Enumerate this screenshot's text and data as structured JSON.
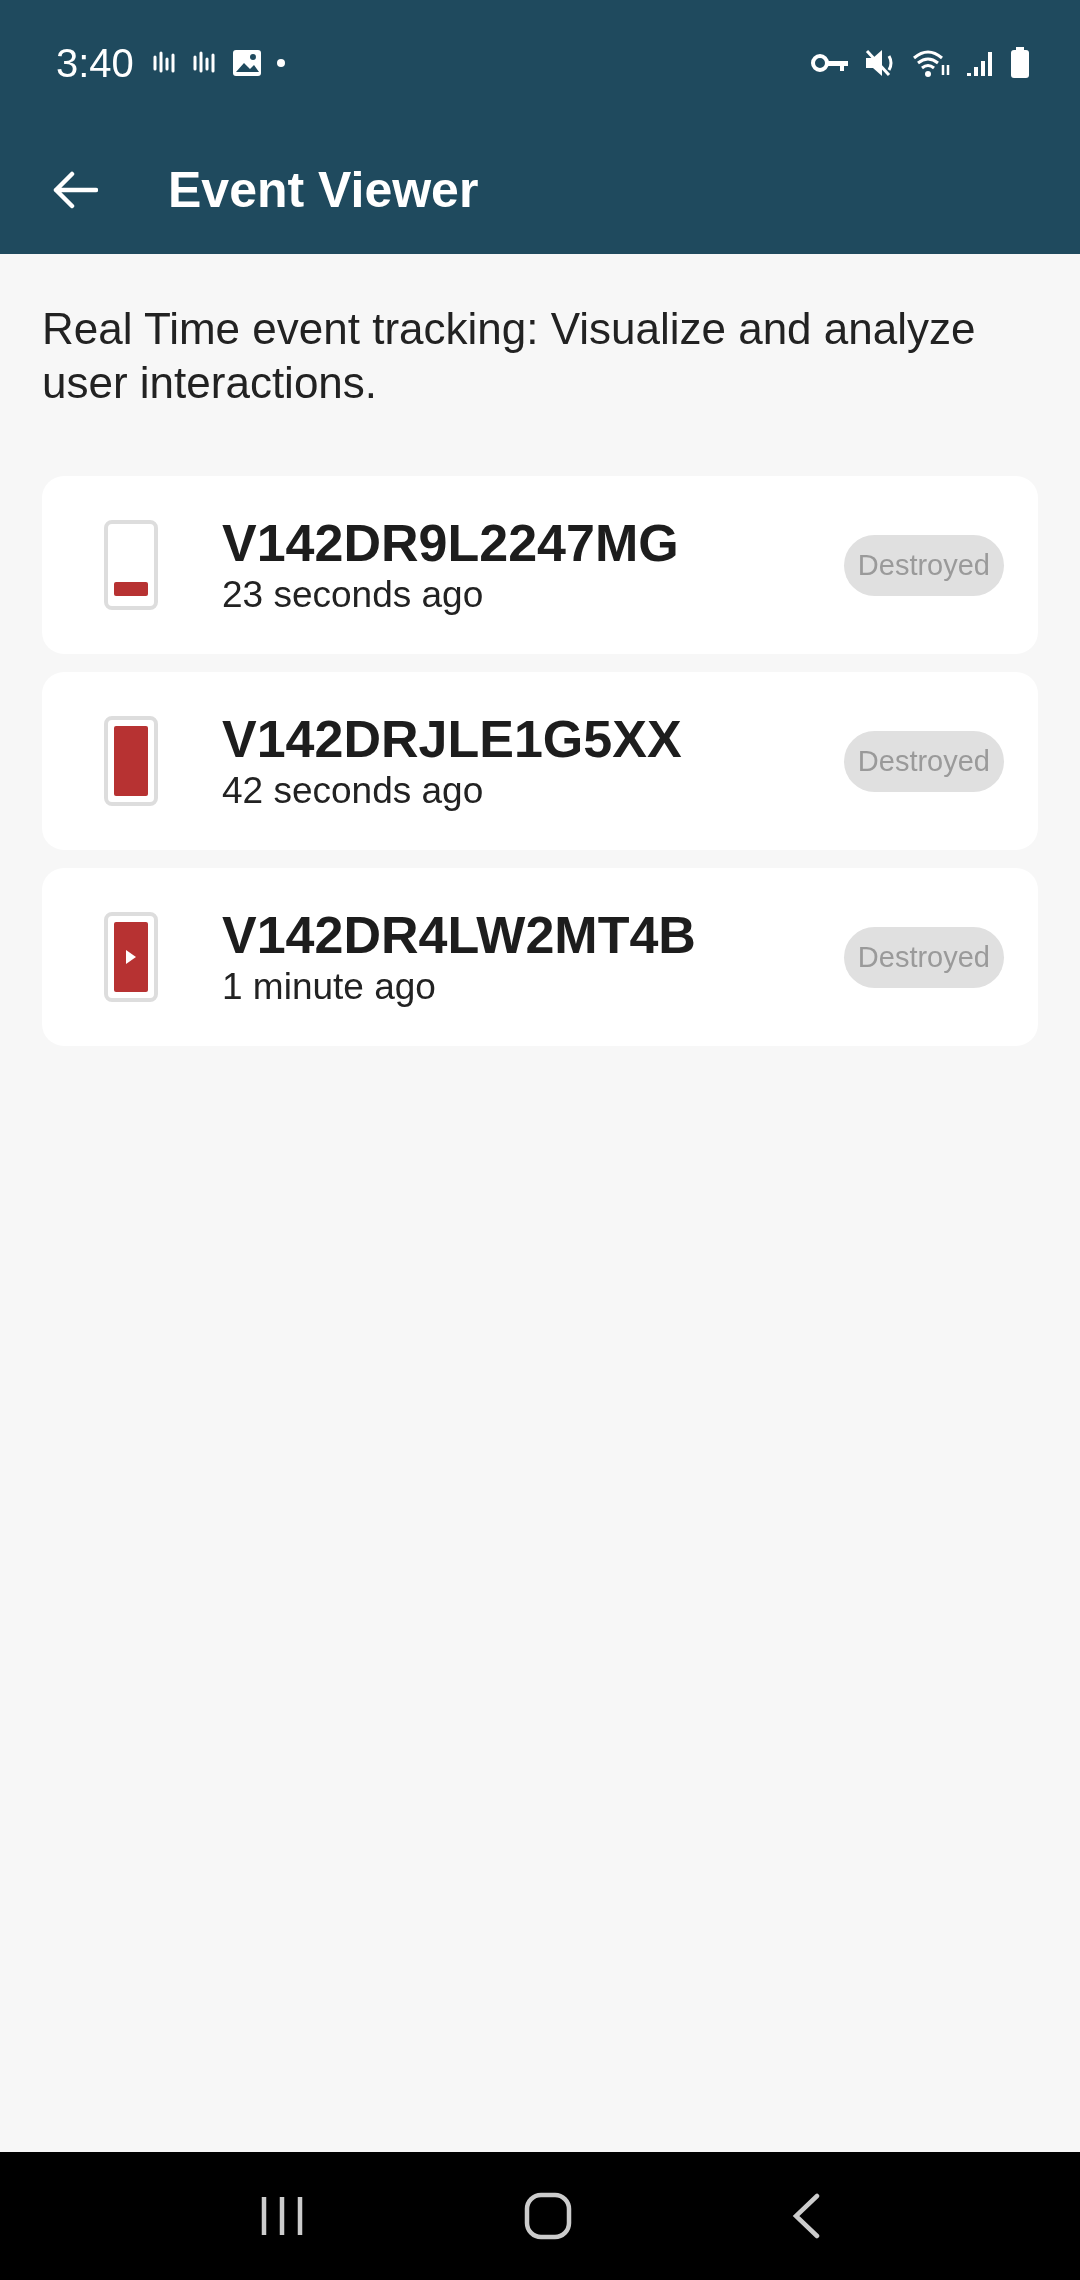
{
  "status_bar": {
    "time": "3:40"
  },
  "app_bar": {
    "title": "Event Viewer"
  },
  "description": "Real Time event tracking: Visualize and analyze user interactions.",
  "events": [
    {
      "id": "V142DR9L2247MG",
      "time": "23 seconds ago",
      "status": "Destroyed",
      "kind": "partial"
    },
    {
      "id": "V142DRJLE1G5XX",
      "time": "42 seconds ago",
      "status": "Destroyed",
      "kind": "full"
    },
    {
      "id": "V142DR4LW2MT4B",
      "time": "1 minute ago",
      "status": "Destroyed",
      "kind": "play"
    }
  ]
}
